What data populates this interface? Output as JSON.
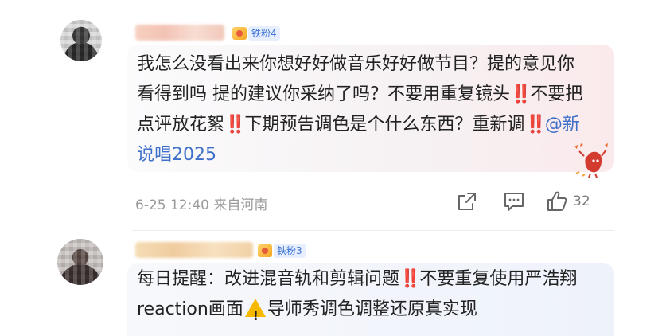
{
  "comments": [
    {
      "badge": "铁粉4",
      "text_parts": [
        "我怎么没看出来你想好好做音乐好好做节目？提的意见你看得到吗 提的建议你采纳了吗？不要用重复镜头",
        "‼️",
        "不要把点评放花絮",
        "‼️",
        "下期预告调色是个什么东西？重新调",
        "‼️",
        "@新说唱2025"
      ],
      "date": "6-25 12:40",
      "location": "来自河南",
      "like_count": "32"
    },
    {
      "badge": "铁粉3",
      "text_parts": [
        "每日提醒：改进混音轨和剪辑问题",
        "‼️",
        "不要重复使用严浩翔reaction画面",
        "导师秀调色调整还原真实现"
      ]
    }
  ],
  "icons": {
    "share": "share-icon",
    "comment": "comment-icon",
    "like": "thumbs-up-icon",
    "warning": "warning-icon"
  },
  "colors": {
    "mention": "#3e6fc9",
    "exclaim": "#e0223a",
    "badge": "#3d74d6"
  }
}
